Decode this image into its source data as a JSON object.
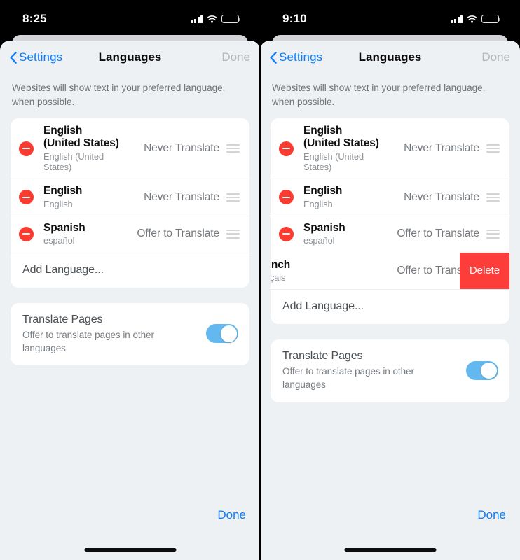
{
  "panels": [
    {
      "status": {
        "time": "8:25",
        "signal_icon": "cellular-signal-icon",
        "wifi_icon": "wifi-icon",
        "battery_icon": "battery-icon"
      },
      "nav": {
        "back_label": "Settings",
        "back_icon": "chevron-left-icon",
        "title": "Languages",
        "done_label": "Done"
      },
      "footnote": "Websites will show text in your preferred language, when possible.",
      "languages": [
        {
          "name": "English (United States)",
          "native": "English (United States)",
          "action": "Never Translate",
          "remove_icon": "minus-circle-icon",
          "reorder_icon": "drag-handle-icon",
          "swiped": false
        },
        {
          "name": "English",
          "native": "English",
          "action": "Never Translate",
          "remove_icon": "minus-circle-icon",
          "reorder_icon": "drag-handle-icon",
          "swiped": false
        },
        {
          "name": "Spanish",
          "native": "español",
          "action": "Offer to Translate",
          "remove_icon": "minus-circle-icon",
          "reorder_icon": "drag-handle-icon",
          "swiped": false
        }
      ],
      "add_language_label": "Add Language...",
      "translate_pages": {
        "title": "Translate Pages",
        "subtitle": "Offer to translate pages in other languages",
        "enabled": true
      },
      "bottom_done_label": "Done"
    },
    {
      "status": {
        "time": "9:10",
        "signal_icon": "cellular-signal-icon",
        "wifi_icon": "wifi-icon",
        "battery_icon": "battery-icon"
      },
      "nav": {
        "back_label": "Settings",
        "back_icon": "chevron-left-icon",
        "title": "Languages",
        "done_label": "Done"
      },
      "footnote": "Websites will show text in your preferred language, when possible.",
      "languages": [
        {
          "name": "English (United States)",
          "native": "English (United States)",
          "action": "Never Translate",
          "remove_icon": "minus-circle-icon",
          "reorder_icon": "drag-handle-icon",
          "swiped": false
        },
        {
          "name": "English",
          "native": "English",
          "action": "Never Translate",
          "remove_icon": "minus-circle-icon",
          "reorder_icon": "drag-handle-icon",
          "swiped": false
        },
        {
          "name": "Spanish",
          "native": "español",
          "action": "Offer to Translate",
          "remove_icon": "minus-circle-icon",
          "reorder_icon": "drag-handle-icon",
          "swiped": false
        },
        {
          "name": "French",
          "native": "français",
          "action": "Offer to Translate",
          "remove_icon": "minus-circle-icon",
          "reorder_icon": "drag-handle-icon",
          "swiped": true,
          "delete_label": "Delete"
        }
      ],
      "add_language_label": "Add Language...",
      "translate_pages": {
        "title": "Translate Pages",
        "subtitle": "Offer to translate pages in other languages",
        "enabled": true
      },
      "bottom_done_label": "Done"
    }
  ],
  "colors": {
    "accent_blue": "#0b7dfb",
    "destructive_red": "#fb3b30",
    "delete_red": "#fc3d39",
    "toggle_on": "#63b8ef",
    "sheet_bg": "#eef1f3",
    "card_bg": "#ffffff",
    "done_disabled": "#b4b8bc"
  }
}
